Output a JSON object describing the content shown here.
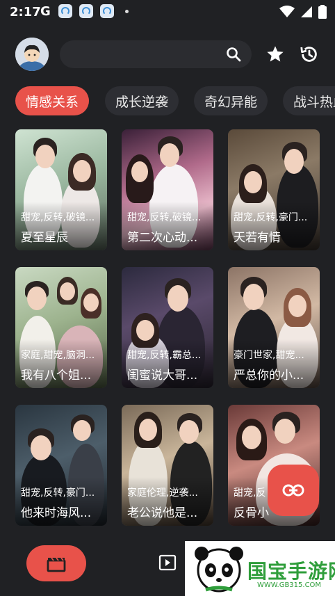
{
  "status_bar": {
    "time": "2:17",
    "g_label": "G"
  },
  "search": {
    "placeholder": ""
  },
  "tabs": [
    "情感关系",
    "成长逆袭",
    "奇幻异能",
    "战斗热血"
  ],
  "active_tab": 0,
  "dramas": [
    {
      "tags": "甜宠,反转,破镜...",
      "title": "夏至星辰"
    },
    {
      "tags": "甜宠,反转,破镜...",
      "title": "第二次心动..."
    },
    {
      "tags": "甜宠,反转,豪门...",
      "title": "天若有情"
    },
    {
      "tags": "家庭,甜宠,脑洞...",
      "title": "我有八个姐..."
    },
    {
      "tags": "甜宠,反转,霸总...",
      "title": "闺蜜说大哥..."
    },
    {
      "tags": "豪门世家,甜宠...",
      "title": "严总你的小..."
    },
    {
      "tags": "甜宠,反转,豪门...",
      "title": "他来时海风..."
    },
    {
      "tags": "家庭伦理,逆袭...",
      "title": "老公说他是..."
    },
    {
      "tags": "甜宠,反",
      "title": "反骨小"
    }
  ],
  "bottom_nav": {
    "tab1_icon": "clapperboard-icon",
    "tab2_icon": "play-icon"
  },
  "watermark": {
    "text": "国宝手游网",
    "url": "WWW.GB315.COM"
  },
  "colors": {
    "accent": "#e8524a",
    "background": "#202124",
    "chip": "#2d2e33"
  }
}
